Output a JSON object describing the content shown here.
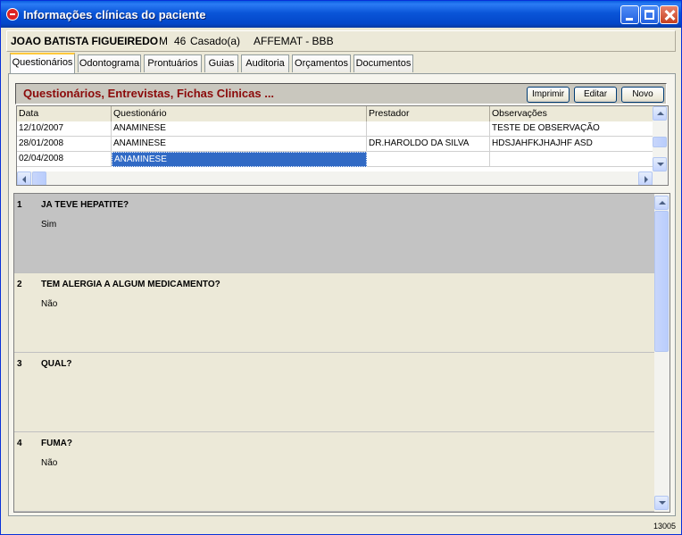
{
  "window": {
    "title": "Informações clínicas do paciente"
  },
  "patient": {
    "name": "JOAO BATISTA FIGUEIREDO",
    "sex": "M",
    "age": "46",
    "civil_status": "Casado(a)",
    "plan": "AFFEMAT - BBB"
  },
  "tabs": [
    {
      "label": "Questionários",
      "active": true
    },
    {
      "label": "Odontograma",
      "active": false
    },
    {
      "label": "Prontuários",
      "active": false
    },
    {
      "label": "Guias",
      "active": false
    },
    {
      "label": "Auditoria",
      "active": false
    },
    {
      "label": "Orçamentos",
      "active": false
    },
    {
      "label": "Documentos",
      "active": false
    }
  ],
  "section": {
    "title": "Questionários, Entrevistas, Fichas Clinicas ...",
    "buttons": {
      "print": "Imprimir",
      "edit": "Editar",
      "new": "Novo"
    }
  },
  "grid": {
    "columns": [
      "Data",
      "Questionário",
      "Prestador",
      "Observações"
    ],
    "rows": [
      [
        "12/10/2007",
        "ANAMINESE",
        "",
        "TESTE DE OBSERVAÇÃO"
      ],
      [
        "28/01/2008",
        "ANAMINESE",
        "DR.HAROLDO DA SILVA",
        "HDSJAHFKJHAJHF ASD"
      ],
      [
        "02/04/2008",
        "ANAMINESE",
        "",
        ""
      ]
    ]
  },
  "questions": [
    {
      "num": "1",
      "text": "JA TEVE HEPATITE?",
      "answer": "Sim"
    },
    {
      "num": "2",
      "text": "TEM ALERGIA A ALGUM MEDICAMENTO?",
      "answer": "Não"
    },
    {
      "num": "3",
      "text": "QUAL?",
      "answer": ""
    },
    {
      "num": "4",
      "text": "FUMA?",
      "answer": "Não"
    }
  ],
  "status": {
    "code": "13005"
  },
  "colors": {
    "titlebar": "#0a55d8",
    "section_title": "#8b0a0a",
    "selection": "#316ac5"
  }
}
